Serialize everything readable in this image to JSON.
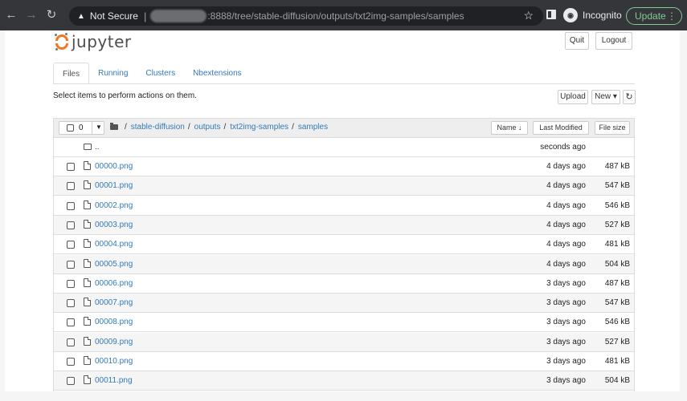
{
  "browser": {
    "security_label": "Not Secure",
    "url_path": ":8888/tree/stable-diffusion/outputs/txt2img-samples/samples",
    "profile_label": "Incognito",
    "update_label": "Update"
  },
  "jupyter": {
    "logo_text": "jupyter",
    "quit_label": "Quit",
    "logout_label": "Logout",
    "tabs": [
      "Files",
      "Running",
      "Clusters",
      "Nbextensions"
    ],
    "select_hint": "Select items to perform actions on them.",
    "upload_label": "Upload",
    "new_label": "New ▾",
    "selected_count": "0",
    "breadcrumb": [
      "stable-diffusion",
      "outputs",
      "txt2img-samples",
      "samples"
    ],
    "sort_name": "Name ↓",
    "sort_modified": "Last Modified",
    "sort_size": "File size",
    "parent_row": {
      "name": "..",
      "modified": "seconds ago"
    },
    "files": [
      {
        "name": "00000.png",
        "modified": "4 days ago",
        "size": "487 kB"
      },
      {
        "name": "00001.png",
        "modified": "4 days ago",
        "size": "547 kB"
      },
      {
        "name": "00002.png",
        "modified": "4 days ago",
        "size": "546 kB"
      },
      {
        "name": "00003.png",
        "modified": "4 days ago",
        "size": "527 kB"
      },
      {
        "name": "00004.png",
        "modified": "4 days ago",
        "size": "481 kB"
      },
      {
        "name": "00005.png",
        "modified": "4 days ago",
        "size": "504 kB"
      },
      {
        "name": "00006.png",
        "modified": "3 days ago",
        "size": "487 kB"
      },
      {
        "name": "00007.png",
        "modified": "3 days ago",
        "size": "547 kB"
      },
      {
        "name": "00008.png",
        "modified": "3 days ago",
        "size": "546 kB"
      },
      {
        "name": "00009.png",
        "modified": "3 days ago",
        "size": "527 kB"
      },
      {
        "name": "00010.png",
        "modified": "3 days ago",
        "size": "481 kB"
      },
      {
        "name": "00011.png",
        "modified": "3 days ago",
        "size": "504 kB"
      }
    ]
  }
}
